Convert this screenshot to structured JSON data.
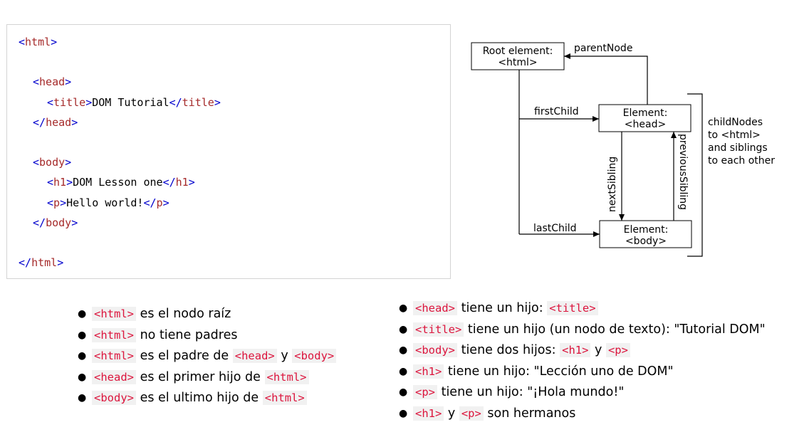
{
  "code_example": {
    "lines": [
      {
        "indent": 0,
        "open": "<html>",
        "content": "",
        "close": ""
      },
      {
        "indent": 0,
        "open": "",
        "content": "",
        "close": ""
      },
      {
        "indent": 1,
        "open": "<head>",
        "content": "",
        "close": ""
      },
      {
        "indent": 2,
        "open": "<title>",
        "content": "DOM Tutorial",
        "close": "</title>"
      },
      {
        "indent": 1,
        "open": "</head>",
        "content": "",
        "close": ""
      },
      {
        "indent": 0,
        "open": "",
        "content": "",
        "close": ""
      },
      {
        "indent": 1,
        "open": "<body>",
        "content": "",
        "close": ""
      },
      {
        "indent": 2,
        "open": "<h1>",
        "content": "DOM Lesson one",
        "close": "</h1>"
      },
      {
        "indent": 2,
        "open": "<p>",
        "content": "Hello world!",
        "close": "</p>"
      },
      {
        "indent": 1,
        "open": "</body>",
        "content": "",
        "close": ""
      },
      {
        "indent": 0,
        "open": "",
        "content": "",
        "close": ""
      },
      {
        "indent": 0,
        "open": "</html>",
        "content": "",
        "close": ""
      }
    ]
  },
  "diagram": {
    "root_box": {
      "line1": "Root element:",
      "line2": "<html>"
    },
    "head_box": {
      "line1": "Element:",
      "line2": "<head>"
    },
    "body_box": {
      "line1": "Element:",
      "line2": "<body>"
    },
    "parent_node": "parentNode",
    "first_child": "firstChild",
    "last_child": "lastChild",
    "next_sibling": "nextSibling",
    "previous_sibling": "previousSibling",
    "child_nodes": [
      "childNodes",
      "to <html>",
      "and siblings",
      "to each other"
    ]
  },
  "left_list": [
    {
      "code1": "<html>",
      "text1": "es el nodo raíz",
      "code2": "",
      "text2": "",
      "code3": "",
      "text3": ""
    },
    {
      "code1": "<html>",
      "text1": "no tiene padres",
      "code2": "",
      "text2": "",
      "code3": "",
      "text3": ""
    },
    {
      "code1": "<html>",
      "text1": "es el padre de",
      "code2": "<head>",
      "text2": "y",
      "code3": "<body>",
      "text3": ""
    },
    {
      "code1": "<head>",
      "text1": "es el primer hijo de",
      "code2": "<html>",
      "text2": "",
      "code3": "",
      "text3": ""
    },
    {
      "code1": "<body>",
      "text1": "es el ultimo hijo de",
      "code2": "<html>",
      "text2": "",
      "code3": "",
      "text3": ""
    }
  ],
  "right_list": [
    {
      "code1": "<head>",
      "text1": "tiene un hijo:",
      "code2": "<title>",
      "text2": "",
      "code3": "",
      "text3": ""
    },
    {
      "code1": "<title>",
      "text1": "tiene un hijo (un nodo de texto): \"Tutorial DOM\"",
      "code2": "",
      "text2": "",
      "code3": "",
      "text3": ""
    },
    {
      "code1": "<body>",
      "text1": "tiene dos hijos:",
      "code2": "<h1>",
      "text2": "y",
      "code3": "<p>",
      "text3": ""
    },
    {
      "code1": "<h1>",
      "text1": "tiene un hijo: \"Lección uno de DOM\"",
      "code2": "",
      "text2": "",
      "code3": "",
      "text3": ""
    },
    {
      "code1": "<p>",
      "text1": "tiene un hijo: \"¡Hola mundo!\"",
      "code2": "",
      "text2": "",
      "code3": "",
      "text3": ""
    },
    {
      "code1": "<h1>",
      "text1": "y",
      "code2": "<p>",
      "text2": "son hermanos",
      "code3": "",
      "text3": ""
    }
  ]
}
